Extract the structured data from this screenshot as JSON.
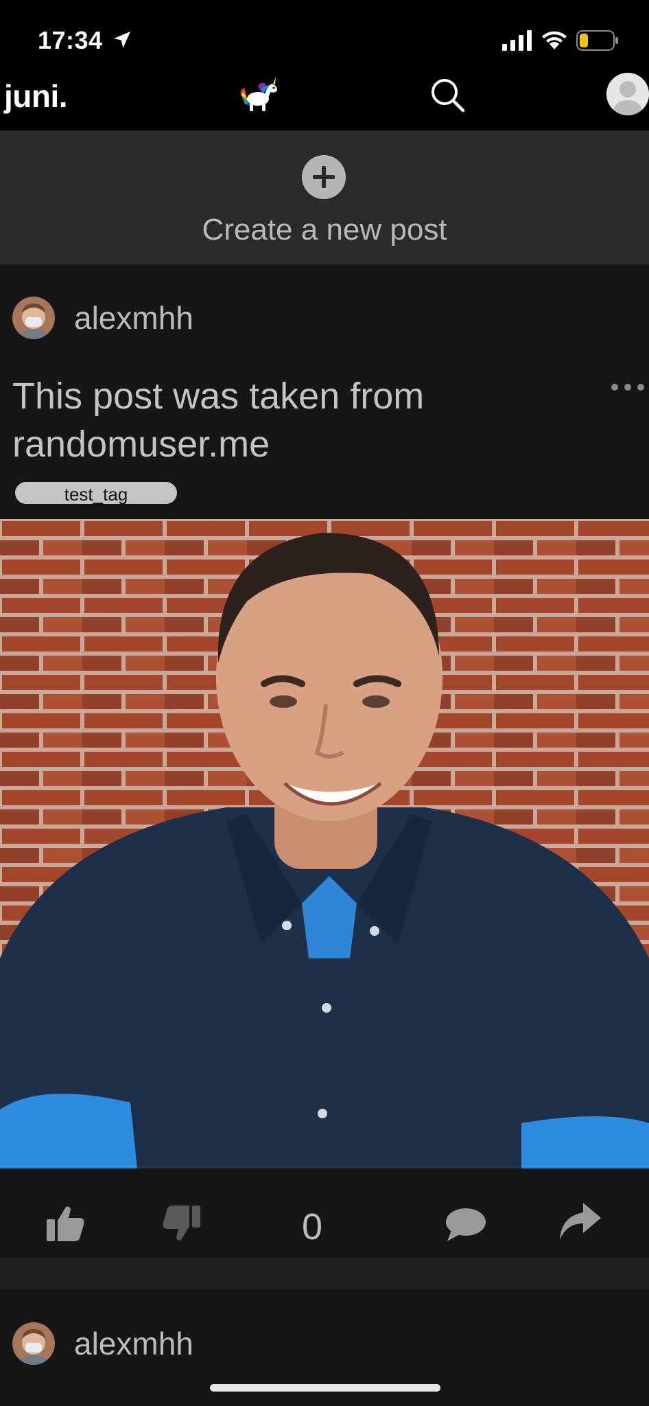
{
  "status_bar": {
    "time": "17:34",
    "icons": [
      "location-arrow-icon",
      "cellular-signal-icon",
      "wifi-icon",
      "battery-low-icon"
    ],
    "battery_color": "#f5c400"
  },
  "nav": {
    "brand": "juni.",
    "icons": [
      "unicorn-logo-icon",
      "search-icon",
      "profile-avatar"
    ]
  },
  "create_post": {
    "label": "Create a new post",
    "icon": "plus-circle-icon"
  },
  "posts": [
    {
      "author": "alexmhh",
      "text": "This post was taken from randomuser.me",
      "tag": "test_tag",
      "score": "0",
      "actions": [
        "thumbs-up-icon",
        "thumbs-down-icon",
        "comment-icon",
        "share-icon"
      ]
    },
    {
      "author": "alexmhh"
    }
  ],
  "colors": {
    "background": "#151515",
    "create_post_bg": "#2a2a2a",
    "text_muted": "#bdbdbd",
    "tag_bg": "#c4c4c4"
  }
}
